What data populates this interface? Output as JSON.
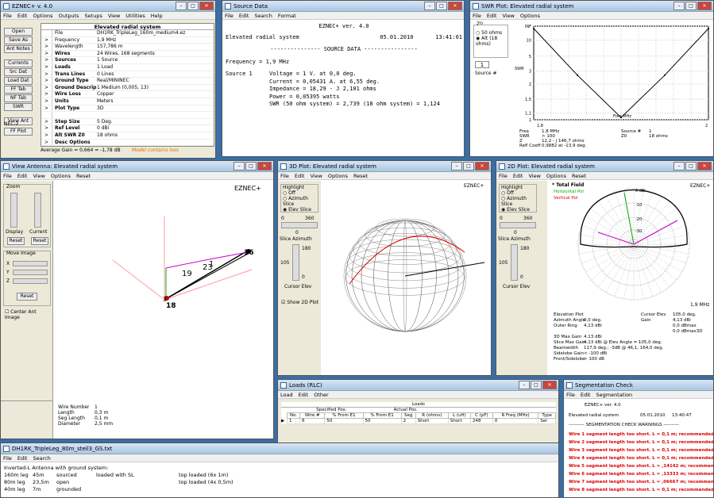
{
  "main": {
    "title": "EZNEC+  v. 4.0",
    "menu": [
      "File",
      "Edit",
      "Options",
      "Outputs",
      "Setups",
      "View",
      "Utilities",
      "Help"
    ],
    "buttons": [
      "Open",
      "Save As",
      "Ant Notes",
      "Currents",
      "Src Dat",
      "Load Dat",
      "FF Tab",
      "NF Tab",
      "SWR",
      "View Ant"
    ],
    "nec": "NEC-2",
    "ffplot": "FF Plot",
    "header": "Elevated radial system",
    "rows": [
      [
        "File",
        "DH1RK_TripleLeg_160m_medium4.ez"
      ],
      [
        "Frequency",
        "1,9 MHz"
      ],
      [
        "Wavelength",
        "157,786 m"
      ],
      [
        "Wires",
        "24 Wires, 168 segments"
      ],
      [
        "Sources",
        "1 Source"
      ],
      [
        "Loads",
        "1 Load"
      ],
      [
        "Trans Lines",
        "0 Lines"
      ],
      [
        "Ground Type",
        "Real/MININEC"
      ],
      [
        "Ground Descrip",
        "1 Medium (0,005, 13)"
      ],
      [
        "Wire Loss",
        "Copper"
      ],
      [
        "Units",
        "Meters"
      ],
      [
        "Plot Type",
        "3D"
      ],
      [
        "",
        ""
      ],
      [
        "Step Size",
        "5 Deg."
      ],
      [
        "Ref Level",
        "0 dBi"
      ],
      [
        "Alt SWR Z0",
        "18 ohms"
      ],
      [
        "Desc Options",
        ""
      ]
    ],
    "avg": "Average Gain = 0,664 = -1,78 dB",
    "warn": "Model contains loss"
  },
  "src": {
    "title": "Source Data",
    "menu": [
      "File",
      "Edit",
      "Search",
      "Format"
    ],
    "head": "EZNEC+ ver. 4.0",
    "name": "Elevated radial system",
    "date": "05.01.2010",
    "time": "13:41:01",
    "sep": "--------------- SOURCE DATA ----------------",
    "freq": "Frequency = 1,9 MHz",
    "label": "Source 1",
    "lines": [
      "Voltage = 1 V. at 0,0 deg.",
      "Current = 0,05431 A. at 6,55 deg.",
      "Impedance = 18,29 - J 2,101 ohms",
      "Power = 0,05395 watts",
      "SWR (50 ohm system) =  2,739  (18 ohm system) =  1,124"
    ]
  },
  "swr": {
    "title": "SWR Plot: Elevated radial system",
    "menu": [
      "File",
      "Edit",
      "View",
      "Options"
    ],
    "z0": "Z0",
    "opt1": "50 ohms",
    "opt2": "Alt (18 ohms)",
    "src": "Source #",
    "srcval": "1",
    "ylabel": "SWR",
    "xlabel": "Freq MHz",
    "xticks": [
      "1,8",
      "2"
    ],
    "yticks": [
      "INF",
      "10",
      "5",
      "3",
      "2",
      "1,5",
      "1,1",
      "1"
    ],
    "info": [
      [
        "Freq",
        "1,8 MHz",
        "Source #",
        "1"
      ],
      [
        "SWR",
        "> 100",
        "Z0",
        "18 ohms"
      ],
      [
        "Z",
        "12,2 - j 146,7 ohms",
        "",
        ""
      ],
      [
        "Refl Coeff",
        "0,9882 at -13,9 deg.",
        "",
        ""
      ]
    ]
  },
  "chart_data": {
    "type": "line",
    "title": "",
    "xlabel": "Freq MHz",
    "ylabel": "SWR",
    "x": [
      1.8,
      1.85,
      1.9,
      1.95,
      2.0
    ],
    "y": [
      100,
      10,
      1.12,
      10,
      100
    ]
  },
  "view": {
    "title": "View Antenna: Elevated radial system",
    "menu": [
      "File",
      "Edit",
      "View",
      "Options",
      "Reset"
    ],
    "brand": "EZNEC+",
    "zoom": "Zoom",
    "display": "Display",
    "current": "Current",
    "reset": "Reset",
    "move": "Move Image",
    "axes": [
      "X",
      "Y",
      "Z"
    ],
    "center": "Center Ant Image",
    "wire": [
      [
        "Wire Number",
        "1"
      ],
      [
        "Length",
        "0,3 m"
      ],
      [
        "Seg Length",
        "0,1 m"
      ],
      [
        "Diameter",
        "2,5 mm"
      ]
    ],
    "labels": [
      "19",
      "23",
      "1",
      "16",
      "18",
      "3"
    ]
  },
  "p3d": {
    "title": "3D Plot: Elevated radial system",
    "menu": [
      "File",
      "Edit",
      "View",
      "Options",
      "Reset"
    ],
    "brand": "EZNEC+",
    "hl": "Highlight",
    "opts": [
      "Off",
      "Azimuth Slice",
      "Elev Slice"
    ],
    "r0": "0",
    "r360": "360",
    "r0b": "0",
    "sa": "Slice Azimuth",
    "c180": "180",
    "c105": "105",
    "c0": "0",
    "ce": "Cursor Elev",
    "show2d": "Show 2D Plot"
  },
  "p2d": {
    "title": "2D Plot: Elevated radial system",
    "menu": [
      "File",
      "Edit",
      "View",
      "Options",
      "Reset"
    ],
    "brand": "EZNEC+",
    "total": "* Total Field",
    "hp": "Horizontal Pol",
    "vp": "Vertical Pol",
    "hl": "Highlight",
    "opts": [
      "Off",
      "Azimuth Slice",
      "Elev Slice"
    ],
    "r0": "0",
    "r360": "360",
    "r0b": "0",
    "sa": "Slice Azimuth",
    "c180": "180",
    "c105": "105",
    "c0": "0",
    "ce": "Cursor Elev",
    "freq": "1,9 MHz",
    "rings": [
      "0 dBi",
      "-10",
      "-20",
      "-30"
    ],
    "info": [
      [
        "Elevation Plot",
        "",
        "Cursor Elev",
        "105,0 deg."
      ],
      [
        "Azimuth Angle",
        "0,0 deg.",
        "Gain",
        "4,13 dBi"
      ],
      [
        "Outer Ring",
        "4,13 dBi",
        "",
        "0,0 dBmax"
      ],
      [
        "",
        "",
        "",
        "0,0 dBmax3D"
      ],
      [
        "3D Max Gain",
        "4,13 dBi",
        "",
        ""
      ],
      [
        "Slice Max Gain",
        "4,13 dBi @ Elev Angle = 105,0 deg.",
        "",
        ""
      ],
      [
        "Beamwidth",
        "117,9 deg.; -3dB @ 46,1, 164,0 deg.",
        "",
        ""
      ],
      [
        "Sidelobe Gain",
        "< -100 dBi",
        "",
        ""
      ],
      [
        "Front/Sidelobe",
        "> 100 dB",
        "",
        ""
      ]
    ]
  },
  "loads": {
    "title": "Loads (RLC)",
    "menu": [
      "Load",
      "Edit",
      "Other"
    ],
    "caption": "Loads",
    "groups": [
      "Specified Pos.",
      "Actual Pos."
    ],
    "cols": [
      "No.",
      "Wire #",
      "% From E1",
      "% From E1",
      "Seg",
      "R (ohms)",
      "L (uH)",
      "C (pF)",
      "R Freq (MHz)",
      "Type"
    ],
    "row": [
      "1",
      "6",
      "50",
      "50",
      "2",
      "Short",
      "Short",
      "248",
      "0",
      "Ser"
    ]
  },
  "txt": {
    "title": "DH1RK_TripleLeg_80m_steil3_GS.txt",
    "menu": [
      "File",
      "Edit",
      "Search"
    ],
    "lines": [
      [
        "Inverted-L Antenna with ground system:",
        "",
        ""
      ],
      [
        "160m leg",
        "45m",
        "sourced",
        "loaded with SL",
        "top loaded (6x 1m)"
      ],
      [
        "80m leg",
        "23,5m",
        "open",
        "",
        "top loaded (4x 0,5m)"
      ],
      [
        "40m leg",
        "7m",
        "grounded",
        "",
        ""
      ]
    ]
  },
  "seg": {
    "title": "Segmentation Check",
    "menu": [
      "File",
      "Edit",
      "Segmentation"
    ],
    "head": "EZNEC+ ver. 4.0",
    "name": "Elevated radial system",
    "date": "05.01.2010",
    "time": "13:40:47",
    "sep": "---------- SEGMENTATION CHECK WARNINGS ----------",
    "warns": [
      "Wire 1 segment length too short. L = 0,1 m; recommended m",
      "Wire 2 segment length too short. L = 0,1 m; recommended m",
      "Wire 3 segment length too short. L = 0,1 m; recommended m",
      "Wire 4 segment length too short. L = 0,1 m; recommended m",
      "Wire 5 segment length too short. L = ,14142 m; recommended",
      "Wire 6 segment length too short. L = ,13333 m; recommended",
      "Wire 7 segment length too short. L = ,06667 m; recommended",
      "Wire 8 segment length too short. L = 0,1 m; recommended m"
    ]
  }
}
